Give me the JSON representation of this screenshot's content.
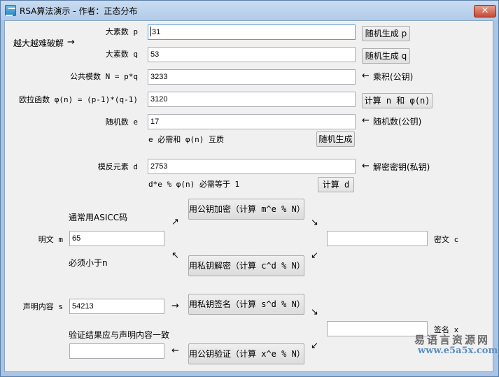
{
  "window": {
    "title": "RSA算法演示 - 作者：正态分布",
    "close_glyph": "✕"
  },
  "note_harder": "越大越难破解",
  "fields": {
    "p": {
      "label": "大素数 p",
      "value": "31",
      "button": "随机生成 p"
    },
    "q": {
      "label": "大素数 q",
      "value": "53",
      "button": "随机生成 q"
    },
    "n": {
      "label": "公共模数 N = p*q",
      "value": "3233",
      "note": "乘积(公钥)"
    },
    "phi": {
      "label": "欧拉函数 φ(n) = (p-1)*(q-1)",
      "value": "3120",
      "button": "计算 n 和 φ(n)"
    },
    "e": {
      "label": "随机数 e",
      "value": "17",
      "note": "随机数(公钥)",
      "hint": "e 必需和 φ(n) 互质",
      "button": "随机生成"
    },
    "d": {
      "label": "模反元素 d",
      "value": "2753",
      "note": "解密密钥(私钥)",
      "hint": "d*e % φ(n) 必需等于 1",
      "button": "计算 d"
    }
  },
  "encryption": {
    "plaintext_label": "明文 m",
    "plaintext_value": "65",
    "hint_ascii": "通常用ASICC码",
    "hint_less": "必须小于n",
    "encrypt_button": "用公钥加密（计算 m^e % N）",
    "decrypt_button": "用私钥解密（计算 c^d % N）",
    "ciphertext_label": "密文 c",
    "ciphertext_value": ""
  },
  "signature": {
    "content_label": "声明内容 s",
    "content_value": "54213",
    "sign_button": "用私钥签名（计算 s^d % N）",
    "signature_label": "签名 x",
    "signature_value": "",
    "verify_hint": "验证结果应与声明内容一致",
    "verify_button": "用公钥验证（计算 x^e % N）",
    "verify_value": ""
  },
  "arrows": {
    "right": "→",
    "left": "←",
    "up_right": "↗",
    "down_right": "↘",
    "down_left": "↙",
    "up_left": "↖"
  },
  "watermark": {
    "cn": "易语言资源网",
    "url": "www.e5a5x.com"
  }
}
